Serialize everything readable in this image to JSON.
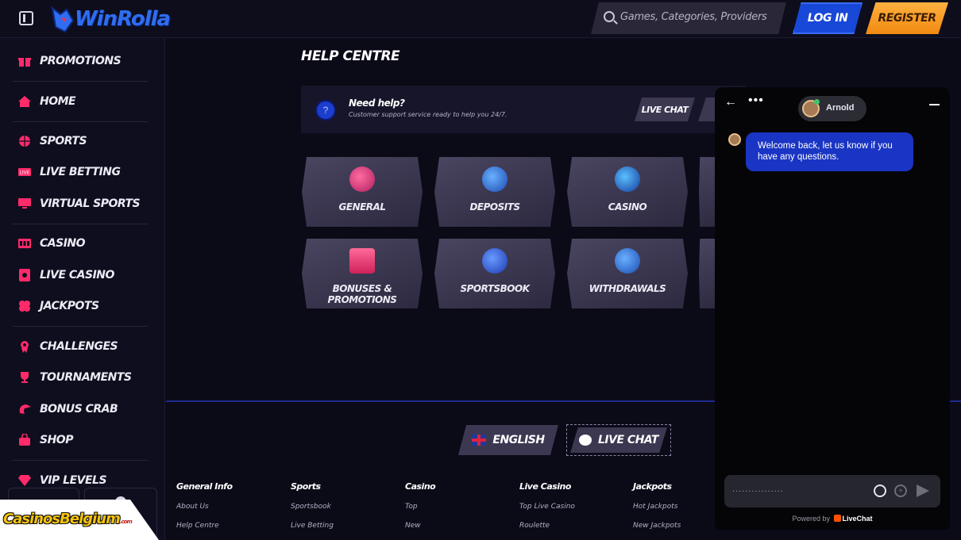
{
  "header": {
    "logo_text": "WinRolla",
    "search_placeholder": "Games, Categories, Providers",
    "login_label": "LOG IN",
    "register_label": "REGISTER"
  },
  "sidebar": {
    "items": [
      {
        "label": "PROMOTIONS",
        "icon": "gift-icon"
      },
      {
        "label": "HOME",
        "icon": "home-icon"
      },
      {
        "label": "SPORTS",
        "icon": "basketball-icon"
      },
      {
        "label": "LIVE BETTING",
        "icon": "live-icon"
      },
      {
        "label": "VIRTUAL SPORTS",
        "icon": "monitor-icon"
      },
      {
        "label": "CASINO",
        "icon": "slot-icon"
      },
      {
        "label": "LIVE CASINO",
        "icon": "card-icon"
      },
      {
        "label": "JACKPOTS",
        "icon": "clover-icon"
      },
      {
        "label": "CHALLENGES",
        "icon": "medal-icon"
      },
      {
        "label": "TOURNAMENTS",
        "icon": "trophy-icon"
      },
      {
        "label": "BONUS CRAB",
        "icon": "claw-icon"
      },
      {
        "label": "SHOP",
        "icon": "bag-icon"
      },
      {
        "label": "VIP LEVELS",
        "icon": "diamond-icon"
      }
    ]
  },
  "main": {
    "title": "HELP CENTRE",
    "help_bar": {
      "title": "Need help?",
      "subtitle": "Customer support service ready to help you 24/7.",
      "live_chat_label": "LIVE CHAT"
    },
    "categories": [
      {
        "label": "GENERAL",
        "color": "#e0408a"
      },
      {
        "label": "DEPOSITS",
        "color": "#2a7ad8"
      },
      {
        "label": "CASINO",
        "color": "#2a6ad0"
      },
      {
        "label": "BONUSES & PROMOTIONS",
        "color": "#ff3a7a"
      },
      {
        "label": "SPORTSBOOK",
        "color": "#2a58d8"
      },
      {
        "label": "WITHDRAWALS",
        "color": "#2a6ad8"
      }
    ]
  },
  "footer": {
    "language_label": "ENGLISH",
    "live_chat_label": "LIVE CHAT",
    "columns": [
      {
        "heading": "General Info",
        "links": [
          "About Us",
          "Help Centre"
        ]
      },
      {
        "heading": "Sports",
        "links": [
          "Sportsbook",
          "Live Betting"
        ]
      },
      {
        "heading": "Casino",
        "links": [
          "Top",
          "New"
        ]
      },
      {
        "heading": "Live Casino",
        "links": [
          "Top Live Casino",
          "Roulette"
        ]
      },
      {
        "heading": "Jackpots",
        "links": [
          "Hot Jackpots",
          "New Jackpots"
        ]
      }
    ]
  },
  "chat": {
    "agent_name": "Arnold",
    "message": "Welcome back, let us know if you have any questions.",
    "typing_indicator": "................",
    "powered_by": "Powered by",
    "brand": "LiveChat"
  },
  "watermark": {
    "text": "CasinosBelgium",
    "suffix": ".com"
  }
}
